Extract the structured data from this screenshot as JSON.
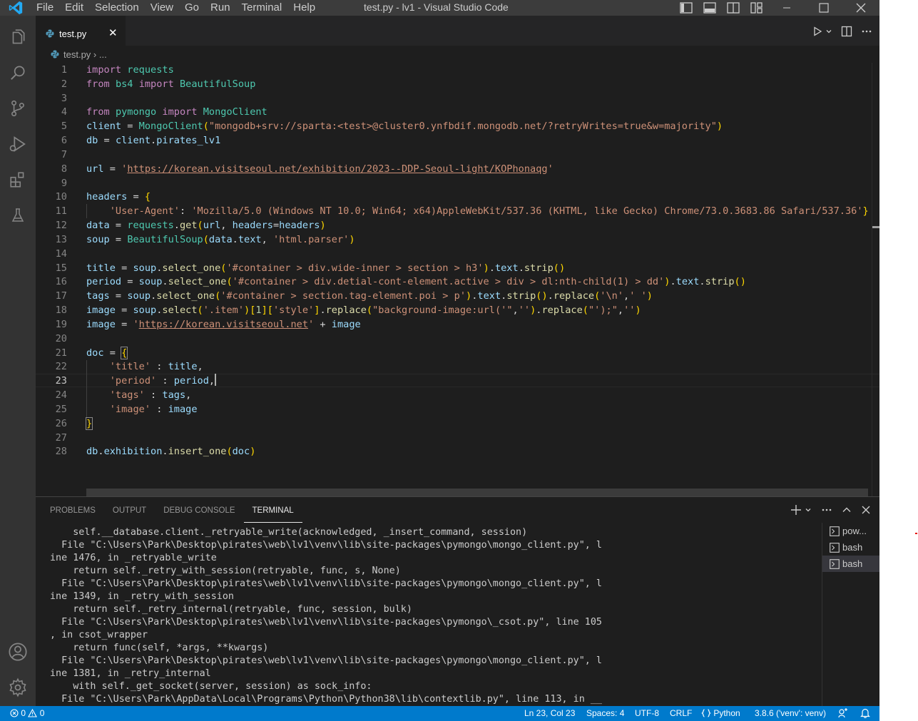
{
  "titlebar": {
    "menu": [
      "File",
      "Edit",
      "Selection",
      "View",
      "Go",
      "Run",
      "Terminal",
      "Help"
    ],
    "window_title": "test.py - lv1 - Visual Studio Code"
  },
  "activity_bar": [
    "explorer-icon",
    "search-icon",
    "source-control-icon",
    "run-debug-icon",
    "extensions-icon",
    "testing-icon",
    "accounts-icon",
    "manage-gear-icon"
  ],
  "tab": {
    "filename": "test.py",
    "close": "✕"
  },
  "breadcrumb": {
    "file": "test.py",
    "separator": "›",
    "rest": "..."
  },
  "editor": {
    "current_line": 23,
    "lines": [
      "import requests",
      "from bs4 import BeautifulSoup",
      "",
      "from pymongo import MongoClient",
      "client = MongoClient(\"mongodb+srv://sparta:<test>@cluster0.ynfbdif.mongodb.net/?retryWrites=true&w=majority\")",
      "db = client.pirates_lv1",
      "",
      "url = 'https://korean.visitseoul.net/exhibition/2023--DDP-Seoul-light/KOPhonaqg'",
      "",
      "headers = {",
      "    'User-Agent': 'Mozilla/5.0 (Windows NT 10.0; Win64; x64)AppleWebKit/537.36 (KHTML, like Gecko) Chrome/73.0.3683.86 Safari/537.36'}",
      "data = requests.get(url, headers=headers)",
      "soup = BeautifulSoup(data.text, 'html.parser')",
      "",
      "title = soup.select_one('#container > div.wide-inner > section > h3').text.strip()",
      "period = soup.select_one('#container > div.detial-cont-element.active > div > dl:nth-child(1) > dd').text.strip()",
      "tags = soup.select_one('#container > section.tag-element.poi > p').text.strip().replace('\\n',' ')",
      "image = soup.select('.item')[1]['style'].replace(\"background-image:url('\",'').replace(\"');\",'')",
      "image = 'https://korean.visitseoul.net' + image",
      "",
      "doc = {",
      "    'title' : title,",
      "    'period' : period,",
      "    'tags' : tags,",
      "    'image' : image",
      "}",
      "",
      "db.exhibition.insert_one(doc)"
    ]
  },
  "panel": {
    "tabs": [
      "PROBLEMS",
      "OUTPUT",
      "DEBUG CONSOLE",
      "TERMINAL"
    ],
    "active_tab": "TERMINAL",
    "terminal_lines": [
      "    self.__database.client._retryable_write(acknowledged, _insert_command, session)",
      "  File \"C:\\Users\\Park\\Desktop\\pirates\\web\\lv1\\venv\\lib\\site-packages\\pymongo\\mongo_client.py\", l",
      "ine 1476, in _retryable_write",
      "    return self._retry_with_session(retryable, func, s, None)",
      "  File \"C:\\Users\\Park\\Desktop\\pirates\\web\\lv1\\venv\\lib\\site-packages\\pymongo\\mongo_client.py\", l",
      "ine 1349, in _retry_with_session",
      "    return self._retry_internal(retryable, func, session, bulk)",
      "  File \"C:\\Users\\Park\\Desktop\\pirates\\web\\lv1\\venv\\lib\\site-packages\\pymongo\\_csot.py\", line 105",
      ", in csot_wrapper",
      "    return func(self, *args, **kwargs)",
      "  File \"C:\\Users\\Park\\Desktop\\pirates\\web\\lv1\\venv\\lib\\site-packages\\pymongo\\mongo_client.py\", l",
      "ine 1381, in _retry_internal",
      "    with self._get_socket(server, session) as sock_info:",
      "  File \"C:\\Users\\Park\\AppData\\Local\\Programs\\Python\\Python38\\lib\\contextlib.py\", line 113, in __"
    ],
    "terminals": [
      "pow...",
      "bash",
      "bash"
    ],
    "selected_terminal": 2
  },
  "status_bar": {
    "errors": "0",
    "warnings": "0",
    "position": "Ln 23, Col 23",
    "spaces": "Spaces: 4",
    "encoding": "UTF-8",
    "eol": "CRLF",
    "language": "Python",
    "interpreter": "3.8.6 ('venv': venv)"
  },
  "colors": {
    "titlebar": "#3c3c3c",
    "activity_bar": "#333333",
    "editor_bg": "#1e1e1e",
    "status_bar": "#007acc",
    "vscode_blue": "#23a9f2"
  }
}
